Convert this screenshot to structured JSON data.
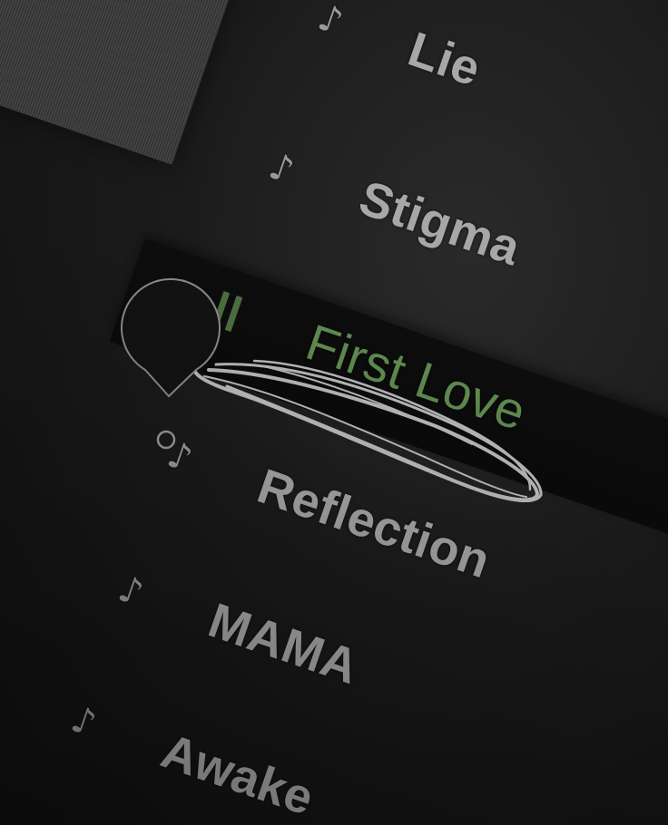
{
  "tracklist": {
    "tracks": [
      {
        "title": "Lie",
        "state": "idle",
        "icon": "music-note-icon"
      },
      {
        "title": "Stigma",
        "state": "idle",
        "icon": "music-note-icon"
      },
      {
        "title": "First Love",
        "state": "playing",
        "icon": "pause-icon"
      },
      {
        "title": "Reflection",
        "state": "idle",
        "icon": "music-note-icon"
      },
      {
        "title": "MAMA",
        "state": "idle",
        "icon": "music-note-icon"
      },
      {
        "title": "Awake",
        "state": "idle",
        "icon": "music-note-icon"
      }
    ],
    "note_glyph": "♪"
  },
  "colors": {
    "background": "#141414",
    "text": "#a7a7a7",
    "playing_text": "#5f8a4f",
    "playing_icon": "#4c6e41",
    "scribble": "#d8d8d8",
    "pin_outline": "#8a8a8a"
  }
}
